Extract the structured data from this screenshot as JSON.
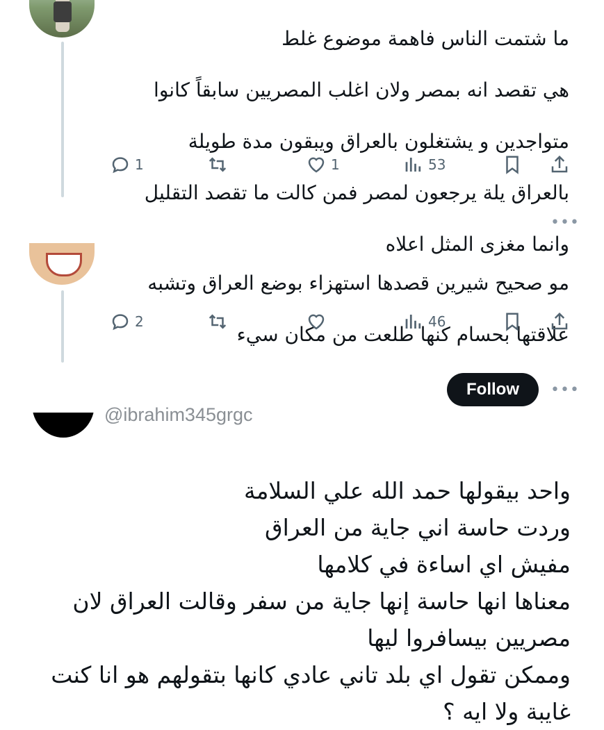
{
  "tweets": [
    {
      "text_lines": [
        "ما شتمت الناس فاهمة موضوع غلط",
        "هي تقصد انه بمصر ولان اغلب المصريين سابقاً كانوا",
        "متواجدين و يشتغلون بالعراق ويبقون مدة طويلة",
        "بالعراق يلة يرجعون لمصر فمن كالت ما تقصد التقليل",
        "وانما مغزى المثل اعلاه"
      ],
      "replies": "1",
      "reposts": "",
      "likes": "1",
      "views": "53"
    },
    {
      "text_lines": [
        "مو صحيح شيرين قصدها استهزاء بوضع العراق وتشبه",
        "علاقتها بحسام كنها طلعت من مكان سيء"
      ],
      "replies": "2",
      "reposts": "",
      "likes": "",
      "views": "46"
    }
  ],
  "more_label": "•••",
  "follow_label": "Follow",
  "third_tweet": {
    "handle": "@ibrahim345grgc",
    "text_lines": [
      "واحد بيقولها حمد الله علي السلامة",
      "وردت حاسة اني جاية من العراق",
      "مفيش اي اساءة في كلامها",
      "معناها انها حاسة إنها جاية من سفر وقالت العراق لان",
      "مصريين بيسافروا ليها",
      "وممكن تقول اي بلد تاني عادي كانها بتقولهم هو انا كنت",
      "غايبة ولا ايه ؟"
    ]
  },
  "icons": {
    "reply": "reply-icon",
    "repost": "repost-icon",
    "like": "heart-icon",
    "views": "views-icon",
    "bookmark": "bookmark-icon",
    "share": "share-icon"
  },
  "colors": {
    "text": "#0f1419",
    "muted": "#536471",
    "thread_line": "#cfd9de",
    "follow_bg": "#0f1419"
  }
}
